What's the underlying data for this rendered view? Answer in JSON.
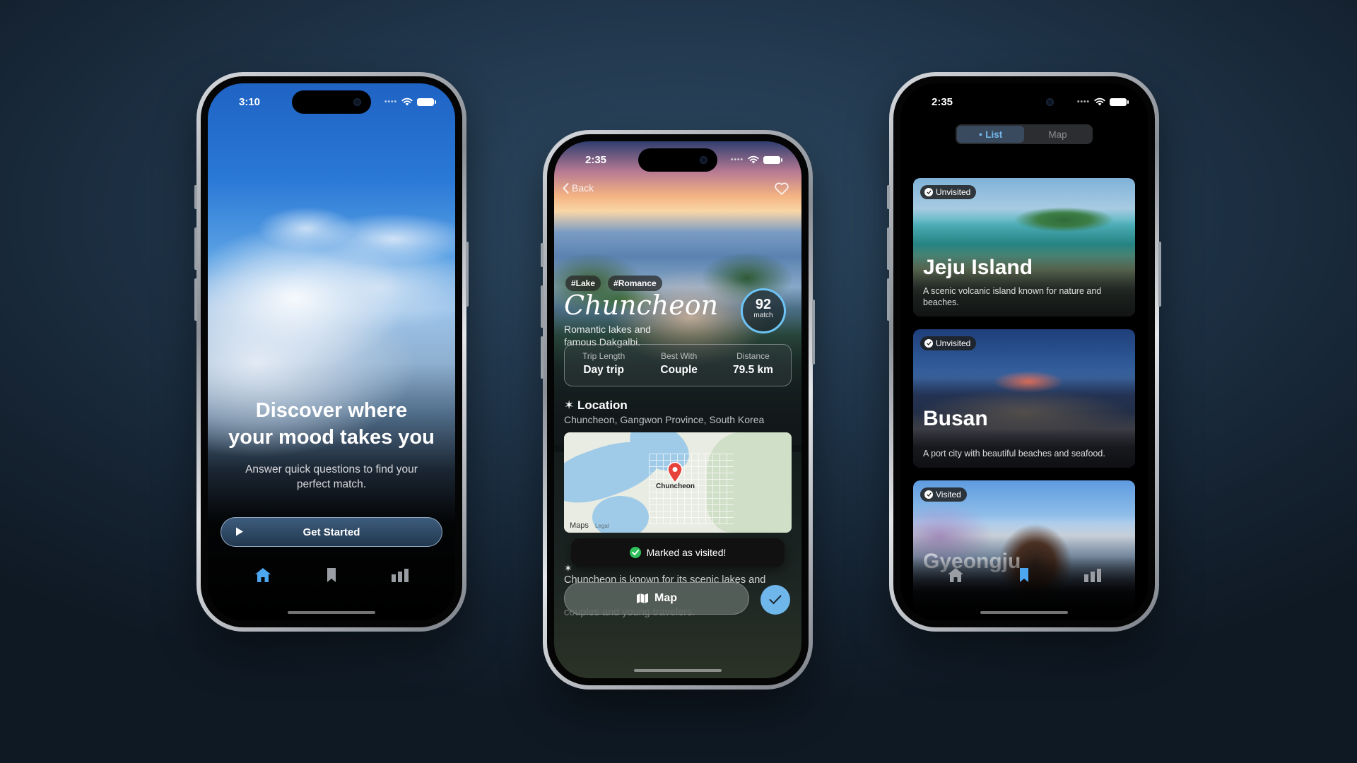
{
  "phone1": {
    "time": "3:10",
    "title_line1": "Discover where",
    "title_line2": "your mood takes you",
    "subtitle": "Answer quick questions to find your perfect match.",
    "cta_label": "Get Started",
    "tabs": [
      "home-icon",
      "bookmark-icon",
      "stats-icon"
    ],
    "active_tab": "home-icon"
  },
  "phone2": {
    "time": "2:35",
    "back_label": "Back",
    "tags": [
      "#Lake",
      "#Romance"
    ],
    "name": "Chuncheon",
    "description": "Romantic lakes and famous Dakgalbi.",
    "match": {
      "value": "92",
      "label": "match"
    },
    "stats": [
      {
        "key": "Trip Length",
        "value": "Day trip"
      },
      {
        "key": "Best With",
        "value": "Couple"
      },
      {
        "key": "Distance",
        "value": "79.5 km"
      }
    ],
    "location_heading": "Location",
    "location_text": "Chuncheon, Gangwon Province, South Korea",
    "map": {
      "pin_label": "Chuncheon",
      "brand": "Maps",
      "legal": "Legal"
    },
    "toast": "Marked as visited!",
    "about_text": "Chuncheon is known for its scenic lakes and",
    "about_text_tail": "couples and young travelers.",
    "map_button_label": "Map",
    "accent": "#6fb6ea"
  },
  "phone3": {
    "time": "2:35",
    "segments": [
      "List",
      "Map"
    ],
    "active_segment": "List",
    "cards": [
      {
        "status": "Unvisited",
        "title": "Jeju Island",
        "desc": "A scenic volcanic island known for nature and beaches."
      },
      {
        "status": "Unvisited",
        "title": "Busan",
        "desc": "A port city with beautiful beaches and seafood."
      },
      {
        "status": "Visited",
        "title": "Gyeongju",
        "desc": ""
      }
    ],
    "tabs": [
      "home-icon",
      "bookmark-icon",
      "stats-icon"
    ],
    "active_tab": "bookmark-icon"
  }
}
